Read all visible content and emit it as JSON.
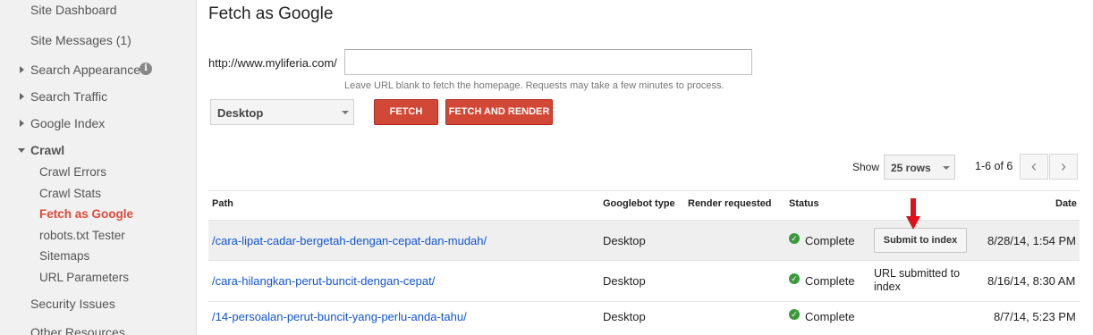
{
  "sidebar": {
    "items": [
      {
        "label": "Site Dashboard"
      },
      {
        "label": "Site Messages (1)"
      },
      {
        "label": "Search Appearance"
      },
      {
        "label": "Search Traffic"
      },
      {
        "label": "Google Index"
      },
      {
        "label": "Crawl"
      },
      {
        "label": "Crawl Errors"
      },
      {
        "label": "Crawl Stats"
      },
      {
        "label": "Fetch as Google"
      },
      {
        "label": "robots.txt Tester"
      },
      {
        "label": "Sitemaps"
      },
      {
        "label": "URL Parameters"
      },
      {
        "label": "Security Issues"
      },
      {
        "label": "Other Resources"
      }
    ],
    "info_glyph": "i"
  },
  "main": {
    "title": "Fetch as Google",
    "url_prefix": "http://www.myliferia.com/",
    "url_value": "",
    "hint": "Leave URL blank to fetch the homepage. Requests may take a few minutes to process.",
    "device": "Desktop",
    "fetch_label": "FETCH",
    "fetch_render_label": "FETCH AND RENDER",
    "show_label": "Show",
    "rows_value": "25 rows",
    "page_count": "1-6 of 6",
    "prev_glyph": "‹",
    "next_glyph": "›"
  },
  "table": {
    "headers": {
      "path": "Path",
      "googlebot": "Googlebot type",
      "render": "Render requested",
      "status": "Status",
      "date": "Date"
    },
    "rows": [
      {
        "path": "/cara-lipat-cadar-bergetah-dengan-cepat-dan-mudah/",
        "type": "Desktop",
        "status": "Complete",
        "action": "Submit to index",
        "date": "8/28/14, 1:54 PM"
      },
      {
        "path": "/cara-hilangkan-perut-buncit-dengan-cepat/",
        "type": "Desktop",
        "status": "Complete",
        "note_line1": "URL submitted to",
        "note_line2": "index",
        "date": "8/16/14, 8:30 AM"
      },
      {
        "path": "/14-persoalan-perut-buncit-yang-perlu-anda-tahu/",
        "type": "Desktop",
        "status": "Complete",
        "date": "8/7/14, 5:23 PM"
      }
    ]
  },
  "colors": {
    "accent_red": "#d14836",
    "active_nav": "#dd4b39",
    "link": "#1155cc",
    "status_green": "#3a9a3a",
    "arrow_red": "#e0101a"
  },
  "check_glyph": "✓"
}
